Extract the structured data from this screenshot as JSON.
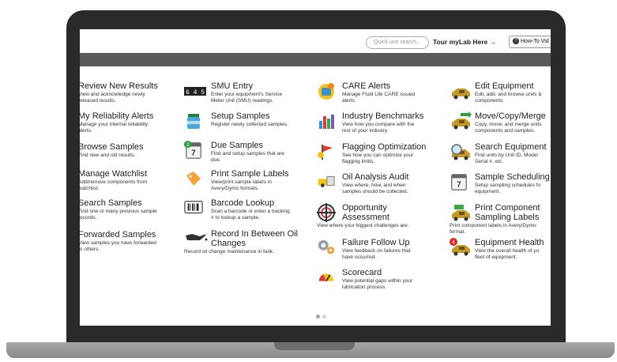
{
  "topbar": {
    "search_placeholder": "Quick unit search...",
    "tour_label": "Tour myLab Here →",
    "howto_label": "How-To Vid"
  },
  "columns": [
    {
      "items": [
        {
          "title": "Review New Results",
          "desc": [
            "View and acknowledge newly",
            "released results."
          ]
        },
        {
          "title": "My Reliability Alerts",
          "desc": [
            "Manage your internal reliability",
            "alerts."
          ]
        },
        {
          "title": "Browse Samples",
          "desc": [
            "Find new and old results."
          ]
        },
        {
          "title": "Manage Watchlist",
          "desc": [
            "Add/remove components from",
            "watchlist."
          ]
        },
        {
          "title": "Search Samples",
          "desc": [
            "Find one or many previous sample",
            "records."
          ]
        },
        {
          "title": "Forwarded Samples",
          "desc": [
            "View samples you have forwarded",
            "to others."
          ]
        }
      ]
    },
    {
      "items": [
        {
          "title": "SMU Entry",
          "desc": [
            "Enter your equipment's Service",
            "Meter Unit (SMU) readings."
          ],
          "icon": "smu-counter-icon"
        },
        {
          "title": "Setup Samples",
          "desc": [
            "Register newly collected samples."
          ],
          "icon": "sample-bottle-icon"
        },
        {
          "title": "Due Samples",
          "desc": [
            "Find and setup samples that are",
            "due."
          ],
          "icon": "calendar-due-icon",
          "badge": "2",
          "cal": "7"
        },
        {
          "title": "Print Sample Labels",
          "desc": [
            "View/print sample labels in",
            "Avery/Dymo formats."
          ],
          "icon": "label-tag-icon"
        },
        {
          "title": "Barcode Lookup",
          "desc": [
            "Scan a barcode or enter a tracking",
            "# to lookup a sample."
          ],
          "icon": "barcode-icon"
        },
        {
          "title": "Record In Between Oil",
          "title2": "Changes",
          "desc": [
            "Record oil change maintenance in bulk."
          ],
          "icon": "oil-can-icon"
        }
      ]
    },
    {
      "items": [
        {
          "title": "CARE Alerts",
          "desc": [
            "Manage Fluid Life CARE issued",
            "alerts."
          ],
          "icon": "care-alert-icon"
        },
        {
          "title": "Industry Benchmarks",
          "desc": [
            "View how you compare with the",
            "rest of your industry."
          ],
          "icon": "bar-chart-icon"
        },
        {
          "title": "Flagging Optimization",
          "desc": [
            "See how you can optimize your",
            "flagging limits."
          ],
          "icon": "flag-icon"
        },
        {
          "title": "Oil Analysis Audit",
          "desc": [
            "View where, how, and when",
            "samples should be collected."
          ],
          "icon": "audit-icon"
        },
        {
          "title": "Opportunity",
          "title2": "Assessment",
          "desc": [
            "View where your biggest challenges are."
          ],
          "icon": "target-icon"
        },
        {
          "title": "Failure Follow Up",
          "desc": [
            "View feedback on failures that",
            "have occurred."
          ],
          "icon": "gears-icon"
        },
        {
          "title": "Scorecard",
          "desc": [
            "View potential gaps within your",
            "lubrication process."
          ],
          "icon": "gauge-icon"
        }
      ]
    },
    {
      "items": [
        {
          "title": "Edit Equipment",
          "desc": [
            "Edit, add, and browse units &",
            "components."
          ],
          "icon": "truck-icon"
        },
        {
          "title": "Move/Copy/Merge",
          "desc": [
            "Copy, move, and merge units",
            "components and samples."
          ],
          "icon": "truck-arrow-icon"
        },
        {
          "title": "Search Equipment",
          "desc": [
            "Find units by Unit ID, Model",
            "Serial #, etc."
          ],
          "icon": "magnifier-truck-icon"
        },
        {
          "title": "Sample Scheduling",
          "desc": [
            "Setup sampling schedules fo",
            "equipment."
          ],
          "icon": "calendar-icon",
          "cal": "7"
        },
        {
          "title": "Print Component",
          "title2": "Sampling Labels",
          "desc": [
            "Print component labels in Avery/Dymo",
            "format."
          ],
          "icon": "truck-label-icon"
        },
        {
          "title": "Equipment Health",
          "desc": [
            "View the overall health of yo",
            "fleet of equipment."
          ],
          "icon": "truck-health-icon",
          "badge": "4"
        }
      ]
    }
  ],
  "smu_digits": "6 4 5",
  "colors": {
    "darkbar": "#5a5a5a",
    "dot_active": "#9aa4b8",
    "dot_inactive": "#d6d6d6"
  }
}
